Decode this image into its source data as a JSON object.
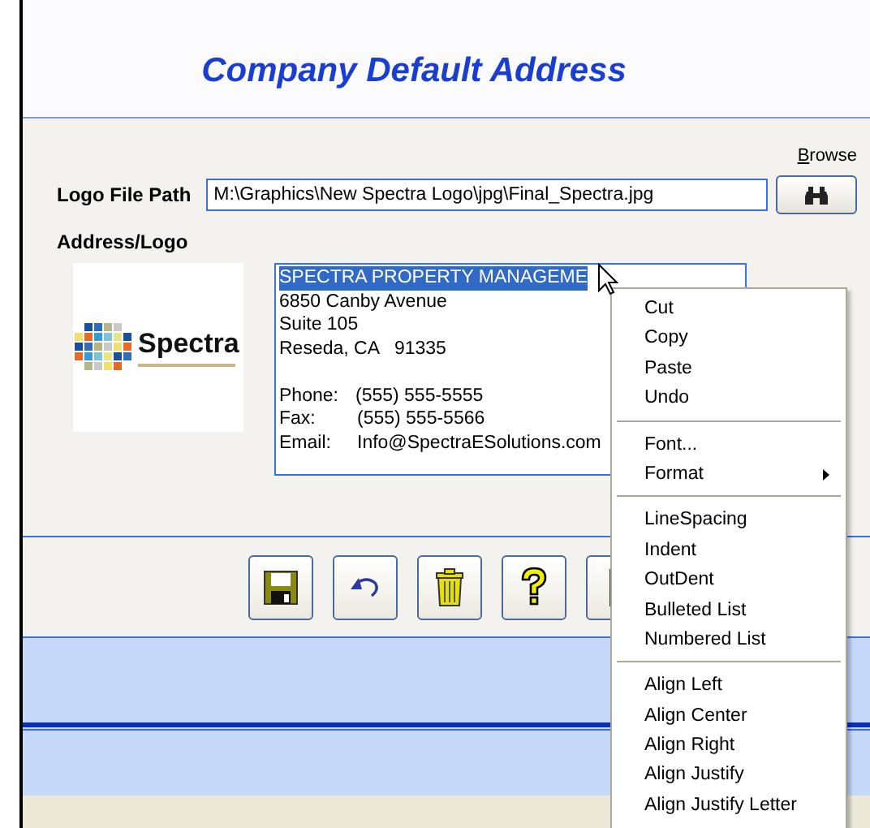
{
  "window": {
    "title": "Company Default Address"
  },
  "browse_link": "Browse",
  "logo_path": {
    "label": "Logo File Path",
    "value": "M:\\Graphics\\New Spectra Logo\\jpg\\Final_Spectra.jpg"
  },
  "address_label": "Address/Logo",
  "logo": {
    "name": "Spectra"
  },
  "address_lines": [
    {
      "text": "SPECTRA PROPERTY MANAGEME",
      "selected": true
    },
    {
      "text": "6850 Canby Avenue",
      "selected": false
    },
    {
      "text": "Suite 105",
      "selected": false
    },
    {
      "text": "Reseda, CA   91335",
      "selected": false
    }
  ],
  "contact_lines": [
    {
      "label": "Phone:",
      "value": "(555) 555-5555"
    },
    {
      "label": "Fax:",
      "value": "(555) 555-5566"
    },
    {
      "label": "Email:",
      "value": "Info@SpectraESolutions.com"
    }
  ],
  "context_menu": [
    [
      {
        "label": "Cut",
        "submenu": false
      },
      {
        "label": "Copy",
        "submenu": false
      },
      {
        "label": "Paste",
        "submenu": false
      },
      {
        "label": "Undo",
        "submenu": false
      }
    ],
    [
      {
        "label": "Font...",
        "submenu": false
      },
      {
        "label": "Format",
        "submenu": true
      }
    ],
    [
      {
        "label": "LineSpacing",
        "submenu": false
      },
      {
        "label": "Indent",
        "submenu": false
      },
      {
        "label": "OutDent",
        "submenu": false
      },
      {
        "label": "Bulleted List",
        "submenu": false
      },
      {
        "label": "Numbered List",
        "submenu": false
      }
    ],
    [
      {
        "label": "Align Left",
        "submenu": false
      },
      {
        "label": "Align Center",
        "submenu": false
      },
      {
        "label": "Align Right",
        "submenu": false
      },
      {
        "label": "Align Justify",
        "submenu": false
      },
      {
        "label": "Align Justify Letter",
        "submenu": false
      }
    ]
  ]
}
